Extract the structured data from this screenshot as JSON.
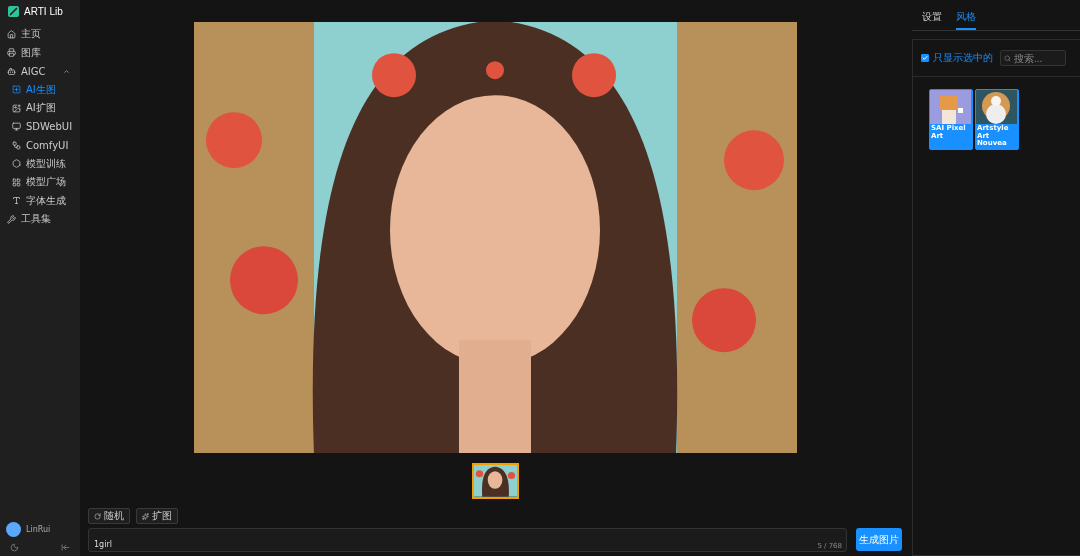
{
  "brand": {
    "name": "ARTI Lib"
  },
  "nav": [
    {
      "label": "主页",
      "selected": false
    },
    {
      "label": "图库",
      "selected": false
    },
    {
      "label": "AIGC",
      "selected": false,
      "expanded": true,
      "children": [
        {
          "label": "AI生图",
          "selected": true
        },
        {
          "label": "AI扩图",
          "selected": false
        },
        {
          "label": "SDWebUI",
          "selected": false
        },
        {
          "label": "ComfyUI",
          "selected": false
        },
        {
          "label": "模型训练",
          "selected": false
        },
        {
          "label": "模型广场",
          "selected": false
        },
        {
          "label": "字体生成",
          "selected": false
        }
      ]
    },
    {
      "label": "工具集",
      "selected": false
    }
  ],
  "user": {
    "name": "LinRui"
  },
  "preview": {
    "thumbnails": [
      {
        "selected": true
      }
    ]
  },
  "prompt": {
    "buttons": [
      {
        "label": "随机"
      },
      {
        "label": "扩图"
      }
    ],
    "value": "1girl",
    "count": "5 / 768",
    "submit": "生成图片"
  },
  "panel": {
    "tabs": [
      {
        "label": "设置",
        "selected": false
      },
      {
        "label": "风格",
        "selected": true
      }
    ],
    "filter": {
      "label": "只显示选中的",
      "checked": true
    },
    "search": {
      "placeholder": "搜索..."
    },
    "styles": [
      {
        "name": "SAI Pixel Art",
        "selected": true
      },
      {
        "name": "Artstyle Art Nouvea",
        "selected": true
      }
    ]
  }
}
